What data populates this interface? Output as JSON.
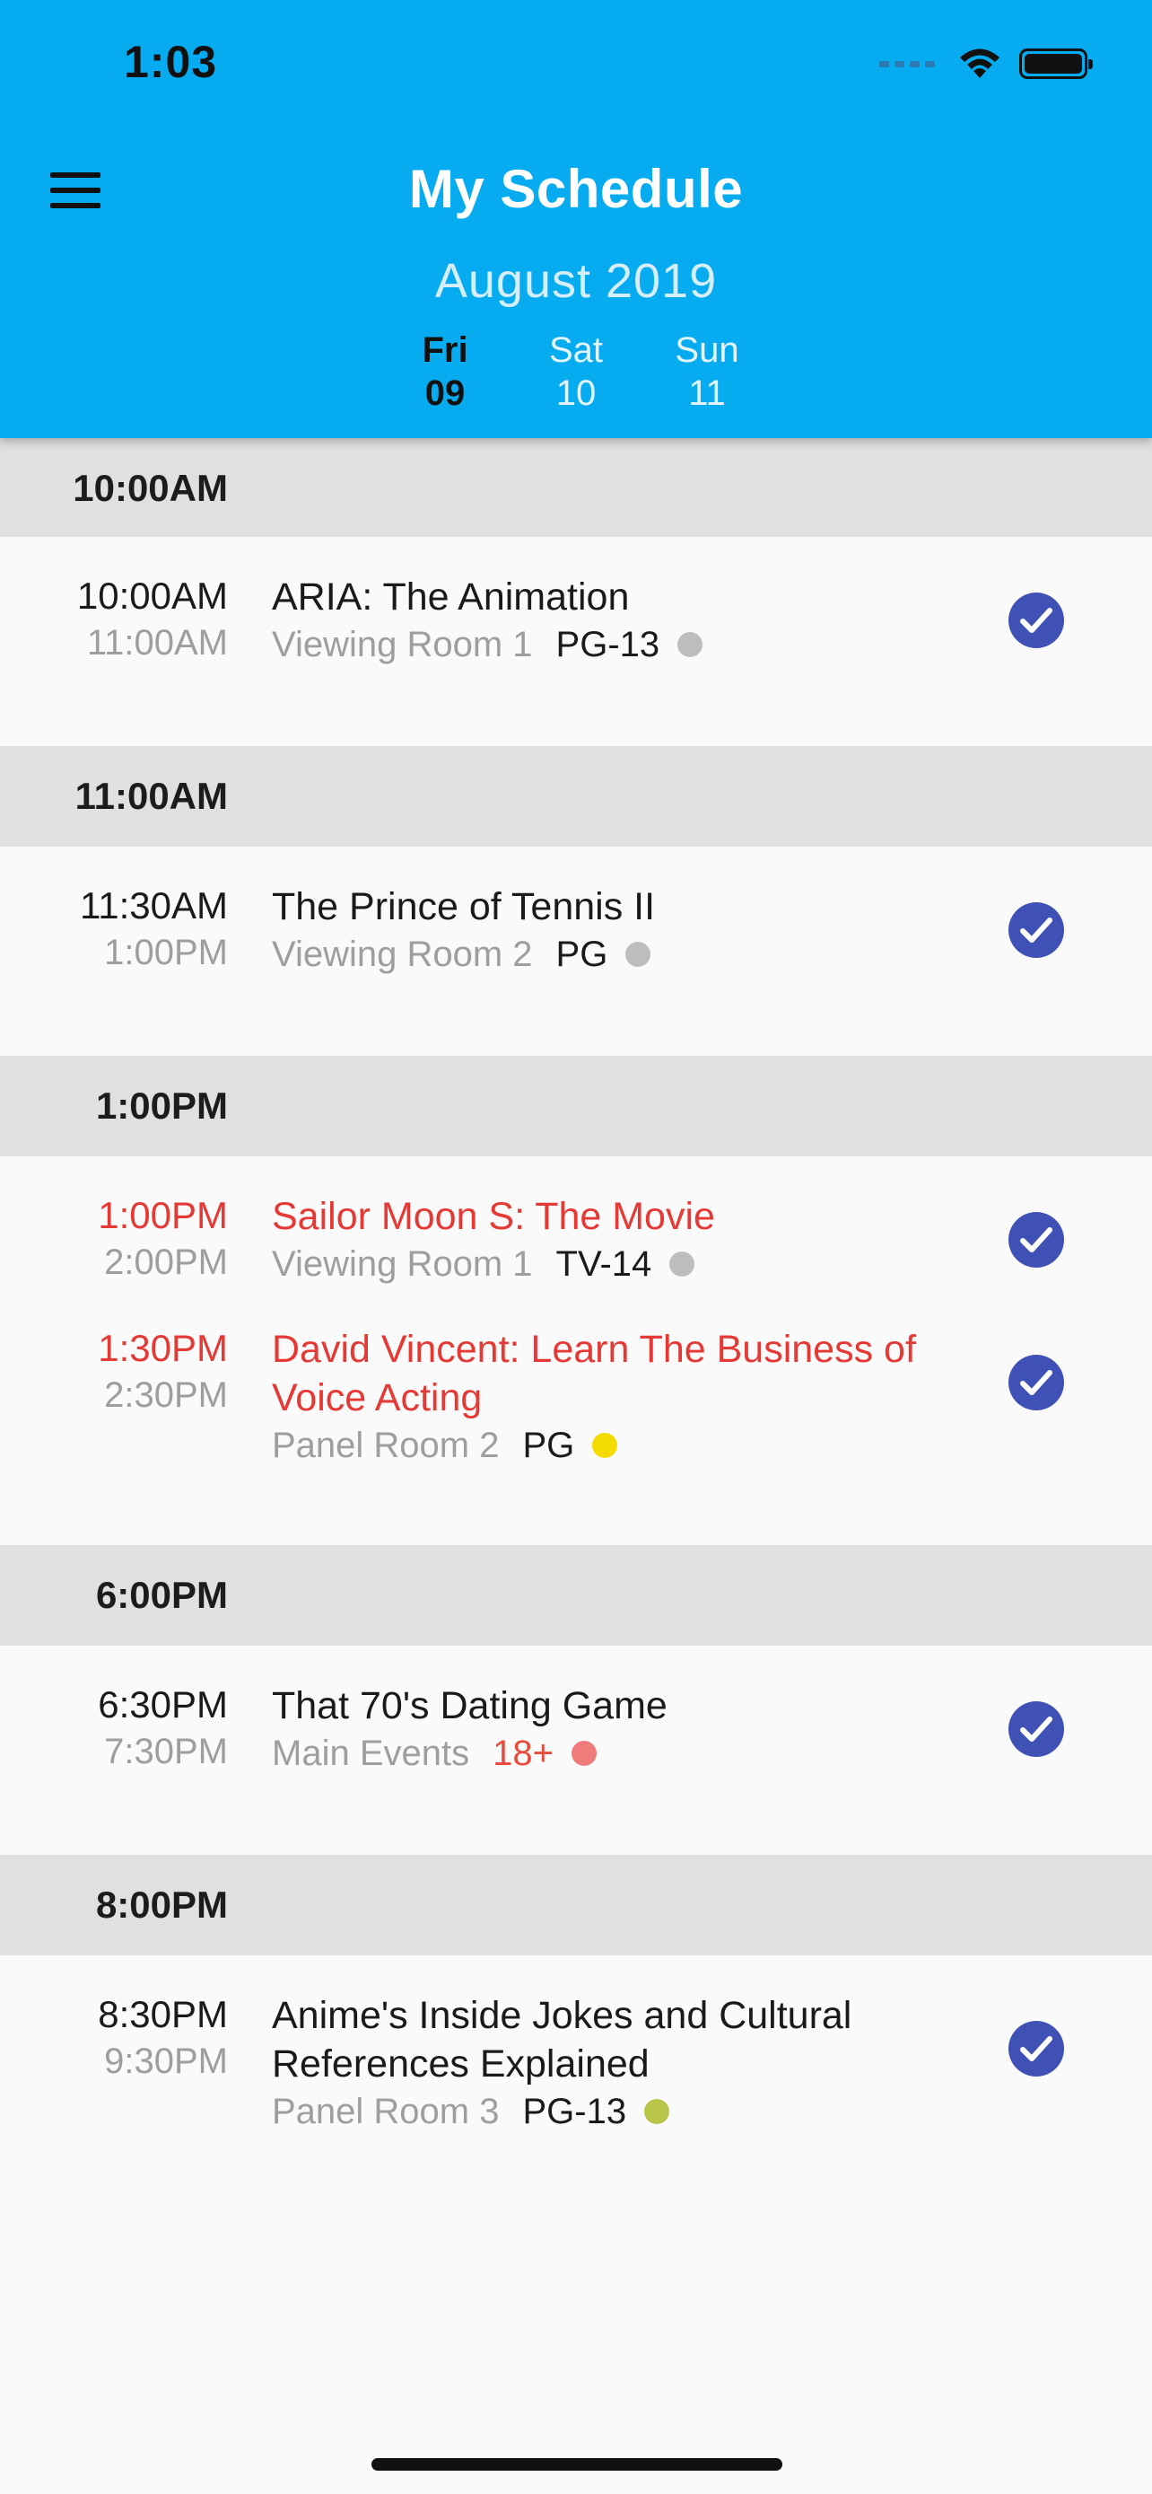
{
  "status_bar": {
    "time": "1:03"
  },
  "header": {
    "title": "My Schedule",
    "month": "August 2019",
    "days": [
      {
        "dow": "Fri",
        "num": "09",
        "active": true
      },
      {
        "dow": "Sat",
        "num": "10",
        "active": false
      },
      {
        "dow": "Sun",
        "num": "11",
        "active": false
      }
    ]
  },
  "colors": {
    "header_bg": "#06acef",
    "check_bg": "#3f51b5",
    "alert_text": "#e53935",
    "dot_grey": "#bdbdbd",
    "dot_yellow": "#f5dc00",
    "dot_red": "#ef7b7b",
    "dot_olive": "#b9c64a"
  },
  "icons": {
    "menu": "hamburger-menu-icon",
    "check": "check-circle-icon",
    "wifi": "wifi-icon",
    "battery": "battery-icon"
  },
  "sections": [
    {
      "label": "10:00AM",
      "events": [
        {
          "start": "10:00AM",
          "end": "11:00AM",
          "title": "ARIA: The Animation",
          "room": "Viewing Room 1",
          "rating": "PG-13",
          "dot": "#bdbdbd",
          "alert": false,
          "selected": true
        }
      ]
    },
    {
      "label": "11:00AM",
      "events": [
        {
          "start": "11:30AM",
          "end": "1:00PM",
          "title": "The Prince of Tennis II",
          "room": "Viewing Room 2",
          "rating": "PG",
          "dot": "#bdbdbd",
          "alert": false,
          "selected": true
        }
      ]
    },
    {
      "label": "1:00PM",
      "events": [
        {
          "start": "1:00PM",
          "end": "2:00PM",
          "title": "Sailor Moon S: The Movie",
          "room": "Viewing Room 1",
          "rating": "TV-14",
          "dot": "#bdbdbd",
          "alert": true,
          "selected": true
        },
        {
          "start": "1:30PM",
          "end": "2:30PM",
          "title": "David Vincent: Learn The Business of Voice Acting",
          "room": "Panel Room 2",
          "rating": "PG",
          "dot": "#f5dc00",
          "alert": true,
          "selected": true
        }
      ]
    },
    {
      "label": "6:00PM",
      "events": [
        {
          "start": "6:30PM",
          "end": "7:30PM",
          "title": "That 70's Dating Game",
          "room": "Main Events",
          "rating": "18+",
          "dot": "#ef7b7b",
          "alert": false,
          "selected": true
        }
      ]
    },
    {
      "label": "8:00PM",
      "events": [
        {
          "start": "8:30PM",
          "end": "9:30PM",
          "title": "Anime's Inside Jokes and Cultural References Explained",
          "room": "Panel Room 3",
          "rating": "PG-13",
          "dot": "#b9c64a",
          "alert": false,
          "selected": true
        }
      ]
    }
  ]
}
